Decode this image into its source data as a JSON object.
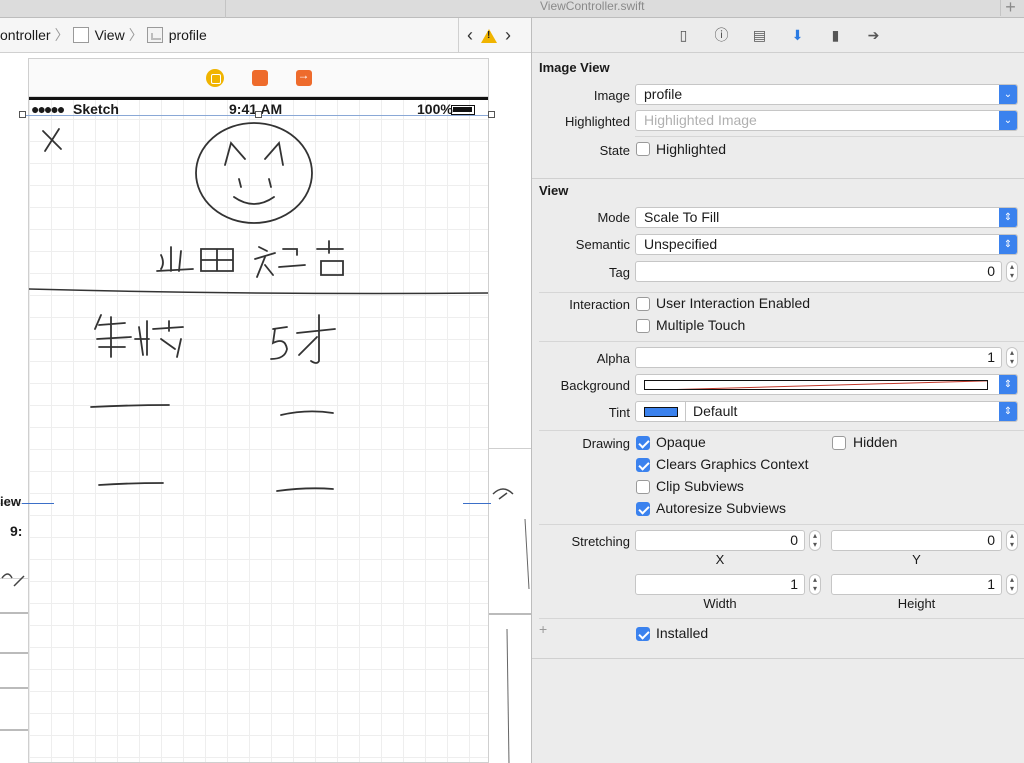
{
  "window": {
    "title": "ViewController.swift"
  },
  "jumpbar": {
    "crumbs": [
      "ontroller",
      "View",
      "profile"
    ]
  },
  "scene": {
    "status": {
      "carrier": "Sketch",
      "time": "9:41 AM",
      "battery": "100%"
    },
    "left_partial_label": "iew",
    "left_partial_time": "9:"
  },
  "inspector": {
    "image_view": {
      "title": "Image View",
      "image_label": "Image",
      "image_value": "profile",
      "highlighted_label": "Highlighted",
      "highlighted_placeholder": "Highlighted Image",
      "state_label": "State",
      "state_option": "Highlighted",
      "state_checked": false
    },
    "view": {
      "title": "View",
      "mode_label": "Mode",
      "mode_value": "Scale To Fill",
      "semantic_label": "Semantic",
      "semantic_value": "Unspecified",
      "tag_label": "Tag",
      "tag_value": "0",
      "interaction_label": "Interaction",
      "user_interaction": "User Interaction Enabled",
      "user_interaction_checked": false,
      "multiple_touch": "Multiple Touch",
      "multiple_touch_checked": false,
      "alpha_label": "Alpha",
      "alpha_value": "1",
      "background_label": "Background",
      "tint_label": "Tint",
      "tint_value": "Default",
      "tint_color": "#3b82ee",
      "drawing_label": "Drawing",
      "opaque": "Opaque",
      "opaque_checked": true,
      "hidden": "Hidden",
      "hidden_checked": false,
      "clears": "Clears Graphics Context",
      "clears_checked": true,
      "clip": "Clip Subviews",
      "clip_checked": false,
      "autoresize": "Autoresize Subviews",
      "autoresize_checked": true,
      "stretching_label": "Stretching",
      "stretch_x": "0",
      "stretch_y": "0",
      "stretch_w": "1",
      "stretch_h": "1",
      "x_label": "X",
      "y_label": "Y",
      "width_label": "Width",
      "height_label": "Height",
      "installed": "Installed",
      "installed_checked": true,
      "add_symbol": "+"
    }
  },
  "colors": {
    "accent": "#3b82ee",
    "warning": "#f0b400",
    "dock_orange": "#ee6b2c"
  }
}
